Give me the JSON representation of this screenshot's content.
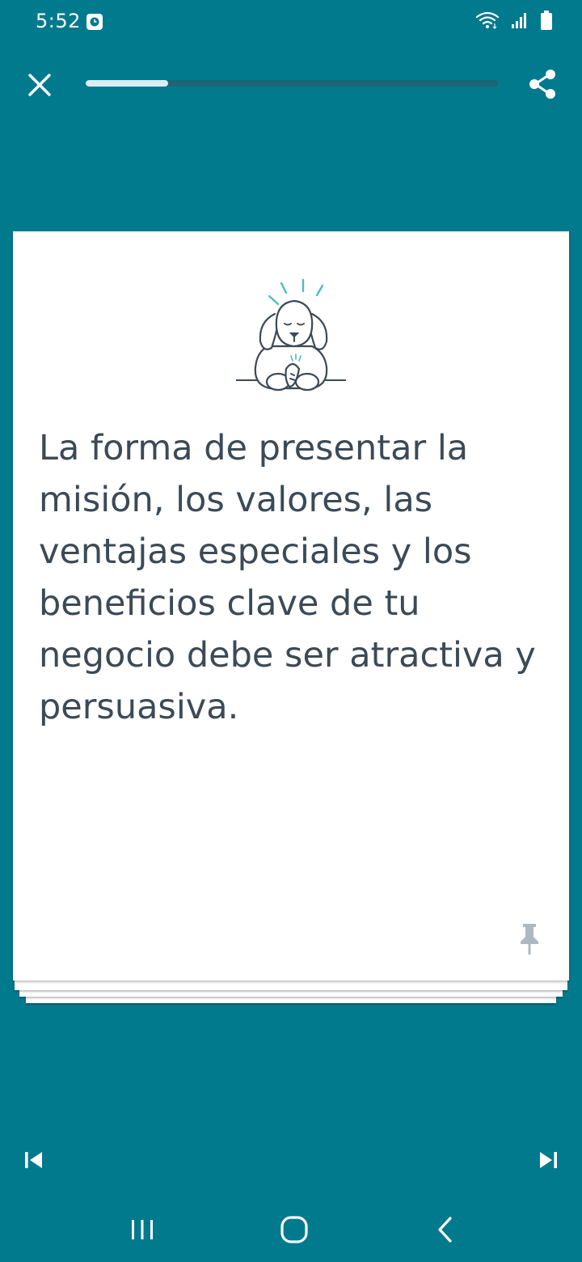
{
  "status_bar": {
    "time": "5:52",
    "icons": [
      "alarm-app-icon",
      "wifi-icon",
      "signal-icon",
      "battery-icon"
    ]
  },
  "toolbar": {
    "close_icon": "close-icon",
    "share_icon": "share-icon",
    "progress": 0.2
  },
  "card": {
    "illustration": "sad-dog-illustration",
    "text": "La forma de presentar la misión, los valores, las ventajas especiales y los beneficios clave de tu negocio debe ser atractiva y persuasiva.",
    "pin_icon": "pin-icon"
  },
  "controls": {
    "prev_icon": "skip-previous-icon",
    "next_icon": "skip-next-icon"
  },
  "system_nav": {
    "recent_icon": "recent-apps-icon",
    "home_icon": "home-icon",
    "back_icon": "back-icon"
  },
  "colors": {
    "background": "#027A8E",
    "card": "#FFFFFF",
    "text": "#3B4A56",
    "accent": "#4DBDBA"
  }
}
